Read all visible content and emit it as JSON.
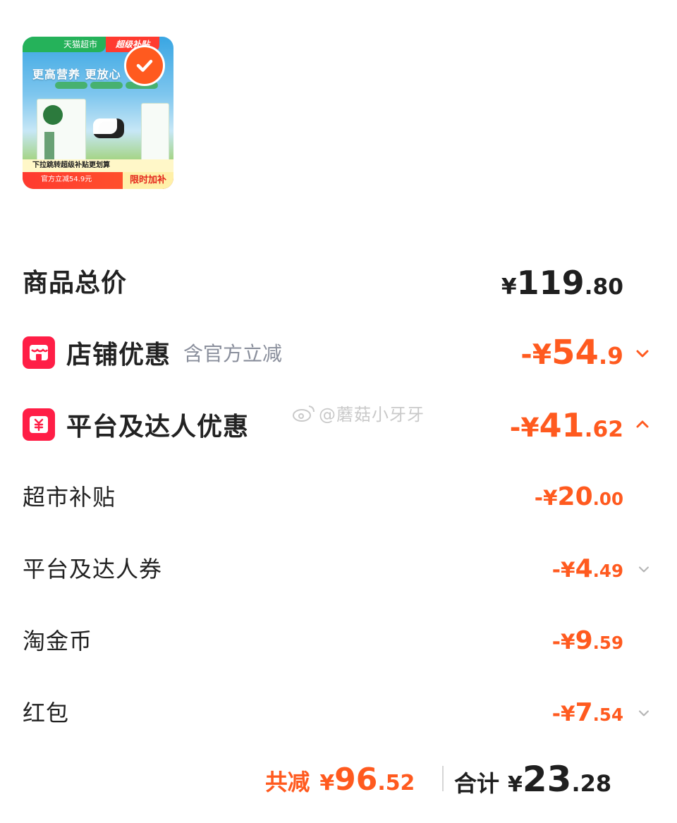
{
  "product": {
    "store_tag": "天猫超市",
    "subsidy_tag": "超级补贴",
    "headline": "更高营养 更放心",
    "promo_line": "下拉跳转超级补贴更划算",
    "promo_discount": "官方立减54.9元",
    "promo_badge": "限时加补",
    "selected": true
  },
  "total": {
    "label": "商品总价",
    "currency": "¥",
    "amount_int": "119",
    "amount_dec": ".80"
  },
  "store_discount": {
    "label": "店铺优惠",
    "note": "含官方立减",
    "sign_currency": "-¥",
    "amount_int": "54",
    "amount_dec": ".9",
    "expanded": false
  },
  "platform_discount": {
    "label": "平台及达人优惠",
    "sign_currency": "-¥",
    "amount_int": "41",
    "amount_dec": ".62",
    "expanded": true,
    "items": [
      {
        "label": "超市补贴",
        "sign_currency": "-¥",
        "amount_int": "20",
        "amount_dec": ".00",
        "has_chevron": false
      },
      {
        "label": "平台及达人券",
        "sign_currency": "-¥",
        "amount_int": "4",
        "amount_dec": ".49",
        "has_chevron": true
      },
      {
        "label": "淘金币",
        "sign_currency": "-¥",
        "amount_int": "9",
        "amount_dec": ".59",
        "has_chevron": false
      },
      {
        "label": "红包",
        "sign_currency": "-¥",
        "amount_int": "7",
        "amount_dec": ".54",
        "has_chevron": true
      }
    ]
  },
  "watermark": "@蘑菇小牙牙",
  "footer": {
    "saved_label": "共减",
    "saved_currency": "¥",
    "saved_int": "96",
    "saved_dec": ".52",
    "total_label": "合计",
    "total_currency": "¥",
    "total_int": "23",
    "total_dec": ".28"
  },
  "colors": {
    "accent": "#ff5a1f",
    "icon_red": "#ff1e46",
    "text_dark": "#1f1f1f",
    "text_muted": "#8a8f9c"
  }
}
